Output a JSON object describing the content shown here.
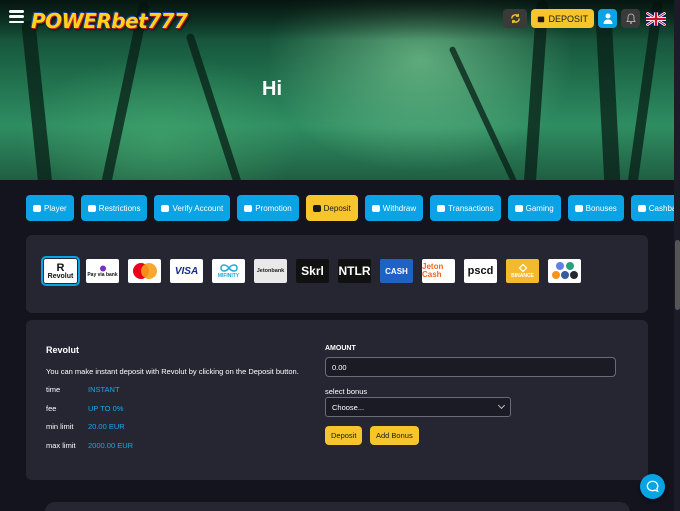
{
  "brand": {
    "logo_text": "POWERbet777"
  },
  "header": {
    "deposit_label": "DEPOSIT",
    "accent": "#f5c52b",
    "primary": "#0aa3e6"
  },
  "hero": {
    "greeting": "Hi"
  },
  "tabs": [
    {
      "label": "Player",
      "icon": "user-icon",
      "active": false
    },
    {
      "label": "Restrictions",
      "icon": "users-icon",
      "active": false
    },
    {
      "label": "Verify Account",
      "icon": "user-check-icon",
      "active": false
    },
    {
      "label": "Promotion",
      "icon": "users-icon",
      "active": false
    },
    {
      "label": "Deposit",
      "icon": "coins-icon",
      "active": true
    },
    {
      "label": "Withdraw",
      "icon": "wallet-icon",
      "active": false
    },
    {
      "label": "Transactions",
      "icon": "exchange-icon",
      "active": false
    },
    {
      "label": "Gaming",
      "icon": "gamepad-icon",
      "active": false
    },
    {
      "label": "Bonuses",
      "icon": "gift-icon",
      "active": false
    },
    {
      "label": "Cashback",
      "icon": "money-icon",
      "active": false
    }
  ],
  "payment_methods": [
    {
      "name": "Revolut",
      "logo_text": "Revolut",
      "active": true
    },
    {
      "name": "Pay via bank",
      "logo_text": "Pay via bank"
    },
    {
      "name": "Mastercard",
      "logo_text": ""
    },
    {
      "name": "Visa",
      "logo_text": "VISA"
    },
    {
      "name": "Mifinity",
      "logo_text": "MIFINITY"
    },
    {
      "name": "Jetonbank",
      "logo_text": "Jetonbank"
    },
    {
      "name": "Skrill",
      "logo_text": "Skrl"
    },
    {
      "name": "Neteller",
      "logo_text": "NTLR"
    },
    {
      "name": "CashtoCode",
      "logo_text": "CASH"
    },
    {
      "name": "Jeton Cash",
      "logo_text": "Jeton Cash"
    },
    {
      "name": "paysafecard",
      "logo_text": "pscd"
    },
    {
      "name": "Binance",
      "logo_text": "BINANCE"
    },
    {
      "name": "Crypto",
      "logo_text": ""
    }
  ],
  "deposit_form": {
    "method_title": "Revolut",
    "description": "You can make instant deposit with Revolut by clicking on the Deposit button.",
    "details": [
      {
        "key": "time",
        "value": "INSTANT"
      },
      {
        "key": "fee",
        "value": "UP TO 0%"
      },
      {
        "key": "min limit",
        "value": "20.00 EUR"
      },
      {
        "key": "max limit",
        "value": "2000.00 EUR"
      }
    ],
    "amount_label": "AMOUNT",
    "amount_value": "0.00",
    "bonus_label": "select bonus",
    "bonus_selected": "Choose...",
    "deposit_button": "Deposit",
    "add_bonus_button": "Add Bonus"
  }
}
